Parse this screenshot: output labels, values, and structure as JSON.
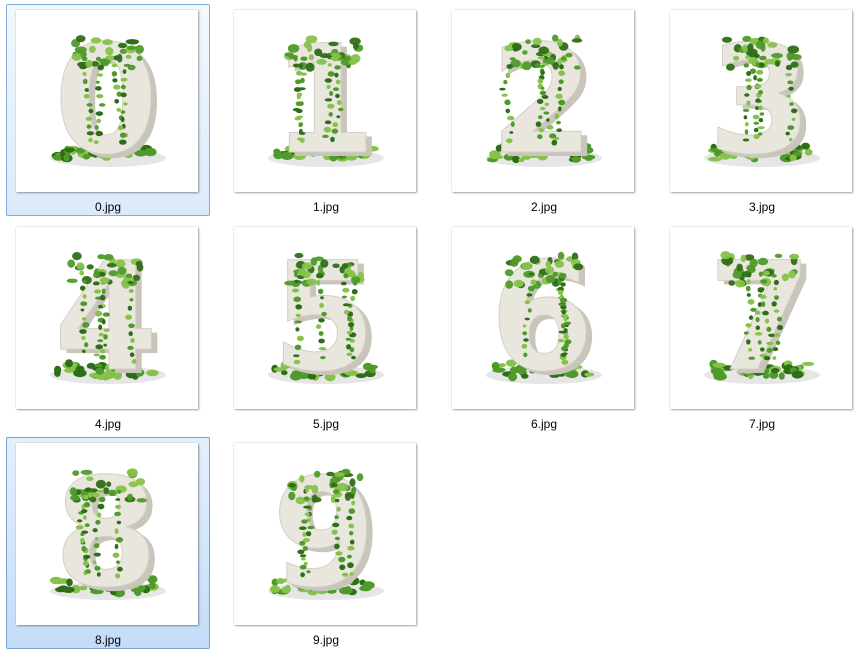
{
  "files": [
    {
      "name": "0.jpg",
      "glyph": "0",
      "state": "selected"
    },
    {
      "name": "1.jpg",
      "glyph": "1",
      "state": "normal"
    },
    {
      "name": "2.jpg",
      "glyph": "2",
      "state": "normal"
    },
    {
      "name": "3.jpg",
      "glyph": "3",
      "state": "normal"
    },
    {
      "name": "4.jpg",
      "glyph": "4",
      "state": "normal"
    },
    {
      "name": "5.jpg",
      "glyph": "5",
      "state": "normal"
    },
    {
      "name": "6.jpg",
      "glyph": "6",
      "state": "normal"
    },
    {
      "name": "7.jpg",
      "glyph": "7",
      "state": "normal"
    },
    {
      "name": "8.jpg",
      "glyph": "8",
      "state": "focused"
    },
    {
      "name": "9.jpg",
      "glyph": "9",
      "state": "normal"
    }
  ],
  "colors": {
    "stone": "#e9e6de",
    "stone_shade": "#c9c5bb",
    "ivy": "#4f9a2a",
    "ivy_dark": "#2f6e18",
    "ivy_light": "#86c24a"
  }
}
